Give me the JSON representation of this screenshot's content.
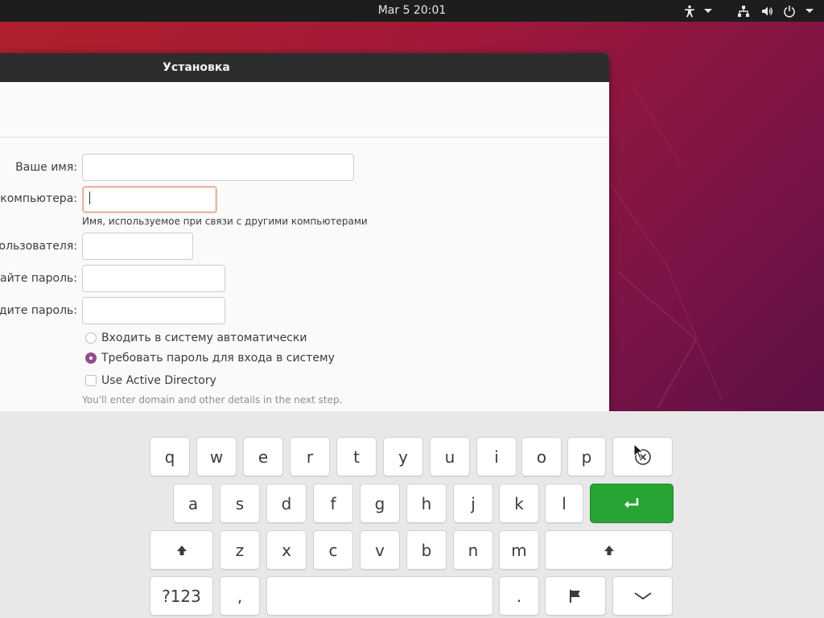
{
  "topbar": {
    "clock": "Mar 5  20:01",
    "icons": [
      "accessibility-icon",
      "network-icon",
      "volume-icon",
      "power-icon"
    ]
  },
  "window": {
    "title": "Установка",
    "form": {
      "name_label": "Ваше имя:",
      "name_value": "",
      "computer_label": "о компьютера:",
      "computer_value": "",
      "computer_hint": "Имя, используемое при связи с другими компьютерами",
      "username_label": "пользователя:",
      "username_value": "",
      "password_label": "дайте пароль:",
      "password_value": "",
      "confirm_label": "одите пароль:",
      "confirm_value": "",
      "login_auto": "Входить в систему автоматически",
      "login_password": "Требовать пароль для входа в систему",
      "login_selected": "password",
      "active_directory": "Use Active Directory",
      "active_directory_checked": false,
      "active_directory_hint": "You'll enter domain and other details in the next step."
    }
  },
  "keyboard": {
    "row1": [
      {
        "label": "q"
      },
      {
        "label": "w"
      },
      {
        "label": "e"
      },
      {
        "label": "r"
      },
      {
        "label": "t"
      },
      {
        "label": "y"
      },
      {
        "label": "u"
      },
      {
        "label": "i"
      },
      {
        "label": "o"
      },
      {
        "label": "p"
      },
      {
        "label": "",
        "icon": "backspace-icon"
      }
    ],
    "row2": [
      {
        "label": "a"
      },
      {
        "label": "s"
      },
      {
        "label": "d"
      },
      {
        "label": "f"
      },
      {
        "label": "g"
      },
      {
        "label": "h"
      },
      {
        "label": "j"
      },
      {
        "label": "k"
      },
      {
        "label": "l"
      },
      {
        "label": "",
        "icon": "enter-icon"
      }
    ],
    "row3": [
      {
        "label": "",
        "icon": "shift-icon"
      },
      {
        "label": "z"
      },
      {
        "label": "x"
      },
      {
        "label": "c"
      },
      {
        "label": "v"
      },
      {
        "label": "b"
      },
      {
        "label": "n"
      },
      {
        "label": "m"
      },
      {
        "label": "",
        "icon": "shift-icon"
      }
    ],
    "row4": [
      {
        "label": "?123"
      },
      {
        "label": ","
      },
      {
        "label": ""
      },
      {
        "label": "."
      },
      {
        "label": "",
        "icon": "language-flag-icon"
      },
      {
        "label": "",
        "icon": "hide-keyboard-icon"
      }
    ],
    "colors": {
      "enter": "#26a434",
      "radio_accent": "#924d8b"
    }
  }
}
